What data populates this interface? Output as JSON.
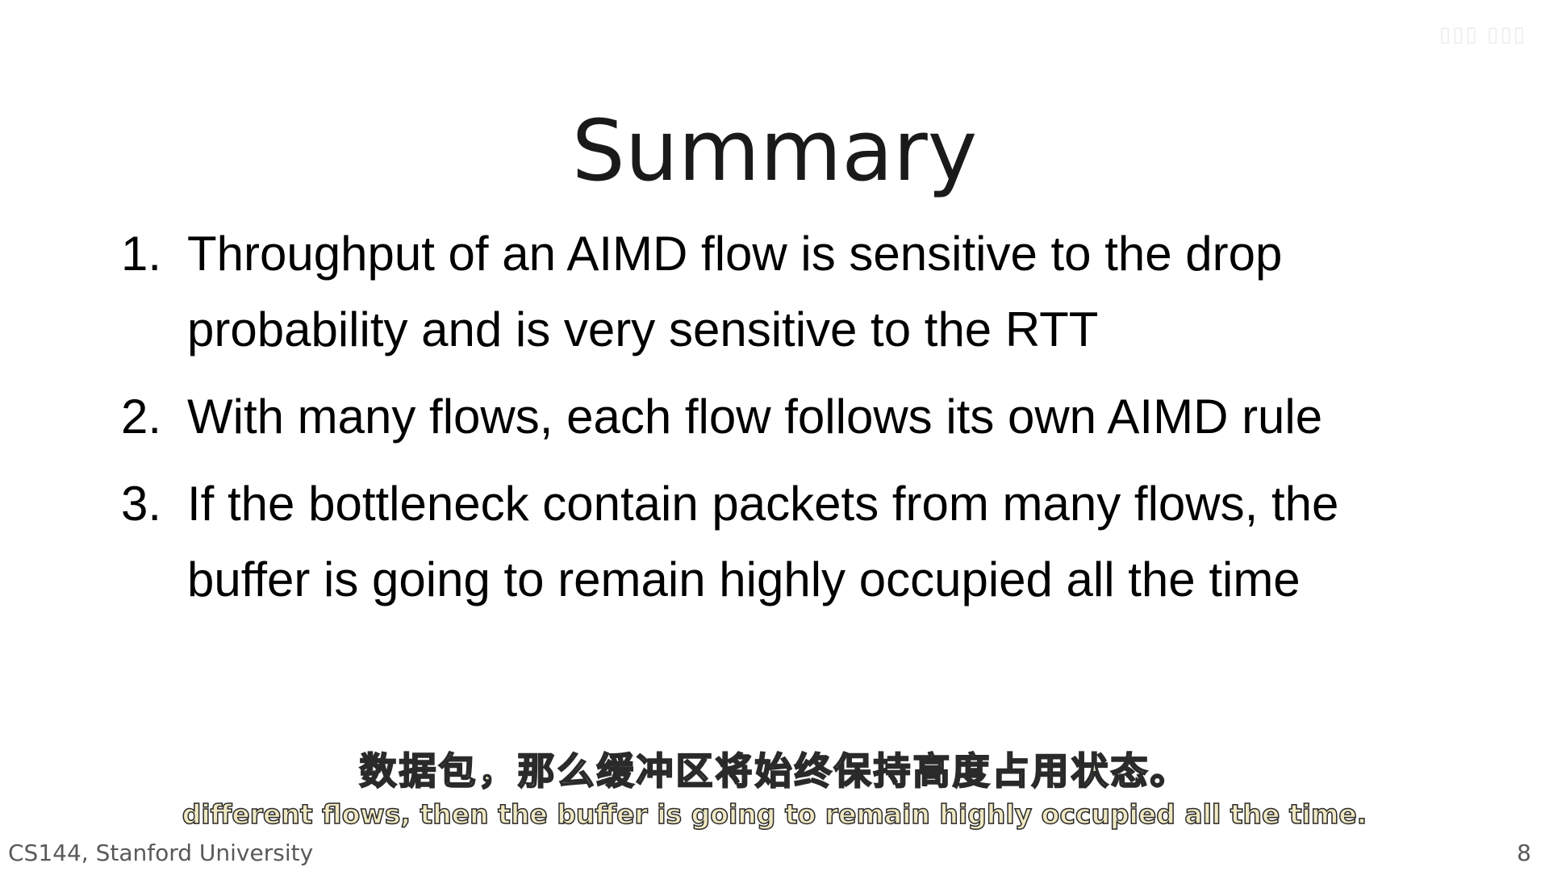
{
  "slide": {
    "title": "Summary",
    "points": [
      {
        "number": "1.",
        "text": "Throughput of an AIMD flow is sensitive to the drop probability and is very sensitive to the RTT"
      },
      {
        "number": "2.",
        "text": "With many flows, each flow follows its own AIMD rule"
      },
      {
        "number": "3.",
        "text": "If the bottleneck contain packets from many flows, the buffer is going to remain highly occupied all the time"
      }
    ],
    "footer_left": "CS144, Stanford University",
    "page_number": "8"
  },
  "subtitles": {
    "chinese": "数据包，那么缓冲区将始终保持高度占用状态。",
    "english": "different flows, then the buffer is going to remain highly occupied all the time."
  }
}
